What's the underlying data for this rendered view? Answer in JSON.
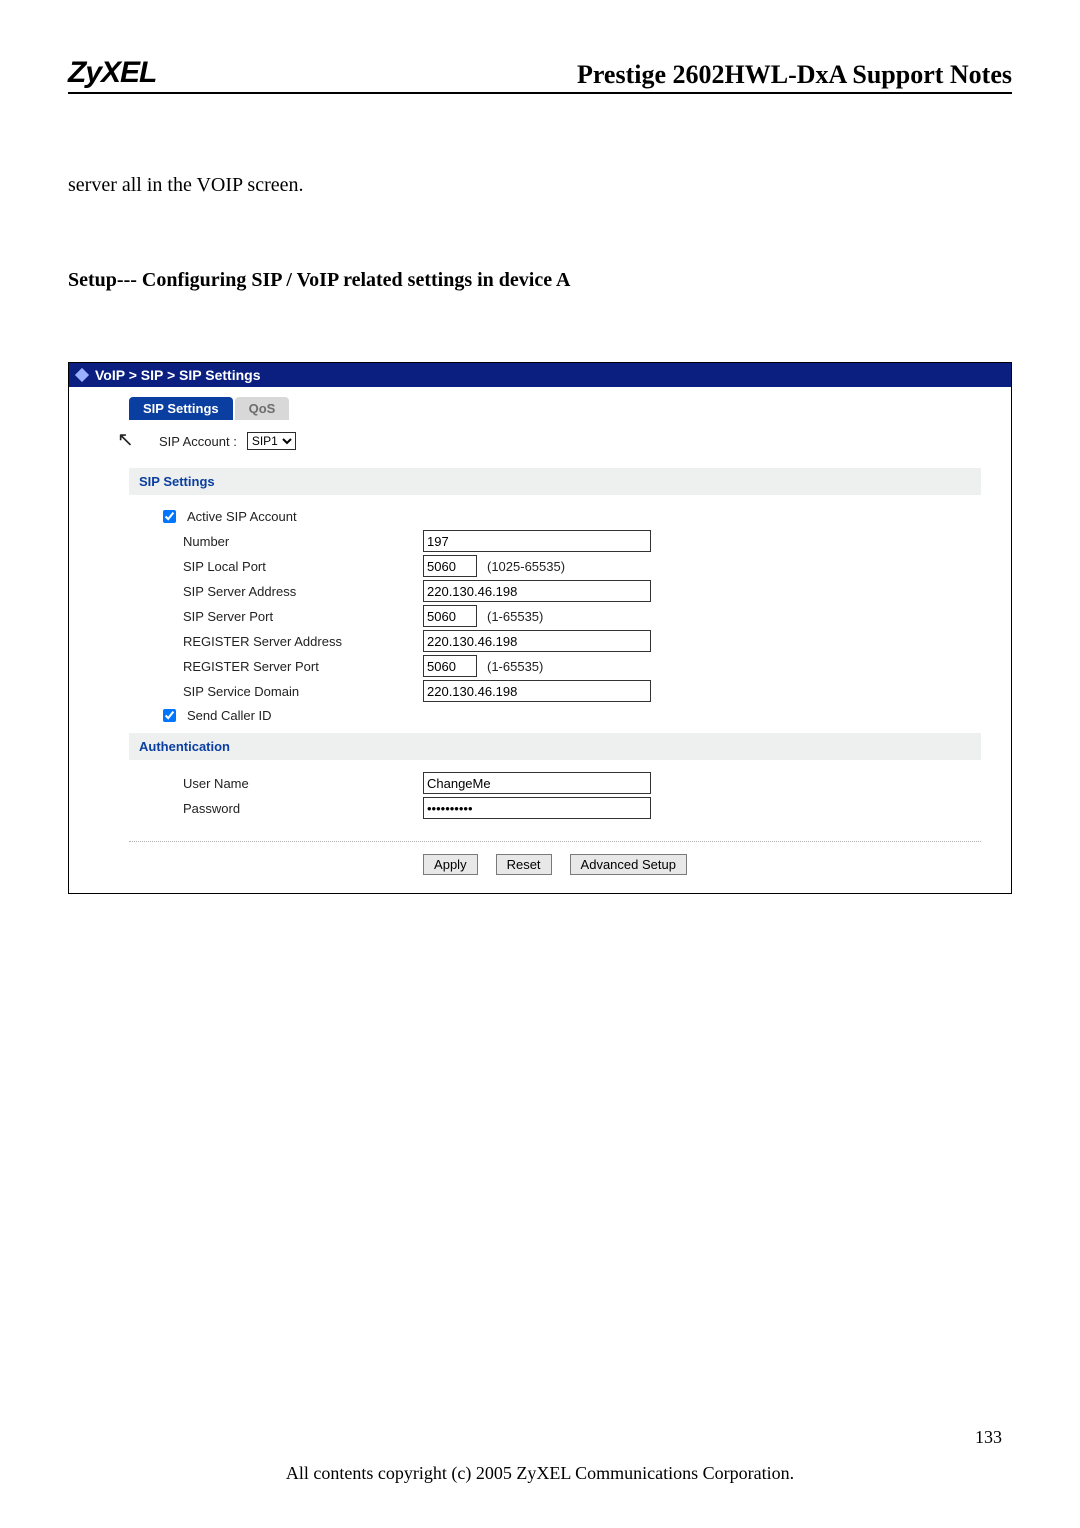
{
  "header": {
    "logo": "ZyXEL",
    "doc_title": "Prestige 2602HWL-DxA Support Notes"
  },
  "intro_text": "server all in the VOIP screen.",
  "section_heading": "Setup--- Configuring SIP / VoIP related settings in device A",
  "breadcrumb": "VoIP > SIP > SIP Settings",
  "tabs": {
    "sip_settings": "SIP Settings",
    "qos": "QoS"
  },
  "sip_account": {
    "label": "SIP Account :",
    "selected": "SIP1"
  },
  "group_sip_settings": {
    "title": "SIP Settings",
    "active_label": "Active SIP Account",
    "active_checked": true,
    "number_label": "Number",
    "number_value": "197",
    "local_port_label": "SIP Local Port",
    "local_port_value": "5060",
    "local_port_range": "(1025-65535)",
    "server_addr_label": "SIP Server Address",
    "server_addr_value": "220.130.46.198",
    "server_port_label": "SIP Server Port",
    "server_port_value": "5060",
    "server_port_range": "(1-65535)",
    "reg_addr_label": "REGISTER Server Address",
    "reg_addr_value": "220.130.46.198",
    "reg_port_label": "REGISTER Server Port",
    "reg_port_value": "5060",
    "reg_port_range": "(1-65535)",
    "domain_label": "SIP Service Domain",
    "domain_value": "220.130.46.198",
    "caller_id_label": "Send Caller ID",
    "caller_id_checked": true
  },
  "group_auth": {
    "title": "Authentication",
    "user_label": "User Name",
    "user_value": "ChangeMe",
    "pass_label": "Password",
    "pass_value": "••••••••••"
  },
  "buttons": {
    "apply": "Apply",
    "reset": "Reset",
    "advanced": "Advanced Setup"
  },
  "page_number": "133",
  "footer": "All contents copyright (c) 2005 ZyXEL Communications Corporation."
}
